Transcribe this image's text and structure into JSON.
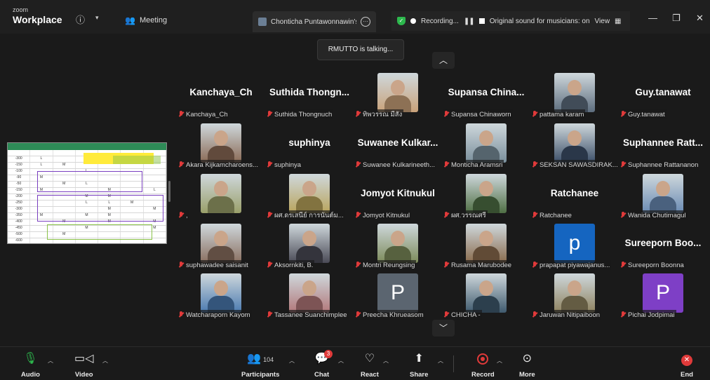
{
  "titlebar": {
    "brand_small": "zoom",
    "brand_big": "Workplace",
    "meeting_label": "Meeting",
    "share_tab_label": "Chonticha Puntawonnawin's s",
    "recording_label": "Recording...",
    "sound_label": "Original sound for musicians: on",
    "view_label": "View"
  },
  "talking": "RMUTTO is talking...",
  "shared_screen": {
    "rows": [
      [
        "",
        "",
        "",
        "",
        "",
        "",
        ""
      ],
      [
        "-300",
        "L",
        "",
        "",
        "",
        "",
        ""
      ],
      [
        "-150",
        "L",
        "M",
        "",
        "",
        "",
        ""
      ],
      [
        "-100",
        "",
        "",
        "L",
        "",
        "",
        ""
      ],
      [
        "-90",
        "M",
        "",
        "",
        "",
        "",
        ""
      ],
      [
        "-50",
        "",
        "M",
        "L",
        "",
        "",
        ""
      ],
      [
        "-150",
        "M",
        "",
        "",
        "M",
        "",
        "L"
      ],
      [
        "-200",
        "",
        "",
        "M",
        "M",
        "",
        ""
      ],
      [
        "-250",
        "",
        "",
        "L",
        "L",
        "M",
        ""
      ],
      [
        "-300",
        "",
        "",
        "",
        "M",
        "",
        "M"
      ],
      [
        "-350",
        "M",
        "",
        "M",
        "M",
        "",
        ""
      ],
      [
        "-400",
        "",
        "M",
        "",
        "M",
        "",
        "M"
      ],
      [
        "-450",
        "",
        "",
        "M",
        "",
        "",
        "M"
      ],
      [
        "-500",
        "",
        "M",
        "",
        "",
        "",
        ""
      ],
      [
        "-600",
        "",
        "",
        "",
        "",
        "",
        ""
      ]
    ]
  },
  "participants": [
    {
      "display": "Kanchaya_Ch",
      "label": "Kanchaya_Ch",
      "type": "name"
    },
    {
      "display": "Suthida Thongn...",
      "label": "Suthida Thongnuch",
      "type": "name"
    },
    {
      "display": "",
      "label": "ทิพวรรณ มีสัง",
      "type": "photo",
      "color": "#c9a27a"
    },
    {
      "display": "Supansa China...",
      "label": "Supansa Chinaworn",
      "type": "name"
    },
    {
      "display": "",
      "label": "pattama karam",
      "type": "photo",
      "color": "#5d6d7e"
    },
    {
      "display": "Guy.tanawat",
      "label": "Guy.tanawat",
      "type": "name"
    },
    {
      "display": "",
      "label": "Akara Kijkamcharoens...",
      "type": "photo",
      "color": "#8a6a55"
    },
    {
      "display": "suphinya",
      "label": "suphinya",
      "type": "name"
    },
    {
      "display": "Suwanee Kulkar...",
      "label": "Suwanee Kulkarineeth...",
      "type": "name"
    },
    {
      "display": "",
      "label": "Monticha Aramsri",
      "type": "photo",
      "color": "#7a8f9c"
    },
    {
      "display": "",
      "label": "SEKSAN SAWASDIRAK...",
      "type": "photo",
      "color": "#3c4f68"
    },
    {
      "display": "Suphannee Ratt...",
      "label": "Suphannee Rattananon",
      "type": "name"
    },
    {
      "display": "",
      "label": ",",
      "type": "photo",
      "color": "#9aa06a"
    },
    {
      "display": "",
      "label": "ผศ.ดรเสนีย์ การนันต์ม...",
      "type": "photo",
      "color": "#b9a45c"
    },
    {
      "display": "Jomyot Kitnukul",
      "label": "Jomyot Kitnukul",
      "type": "name"
    },
    {
      "display": "",
      "label": "ผศ.วรรณศรี",
      "type": "photo",
      "color": "#4f6f44"
    },
    {
      "display": "Ratchanee",
      "label": "Ratchanee",
      "type": "name"
    },
    {
      "display": "",
      "label": "Wanida Chutimagul",
      "type": "photo",
      "color": "#6a8bb4"
    },
    {
      "display": "",
      "label": "suphawadee saisanit",
      "type": "photo",
      "color": "#8a6f60"
    },
    {
      "display": "",
      "label": "Aksornkiti, B.",
      "type": "photo",
      "color": "#4a4a56"
    },
    {
      "display": "",
      "label": "Montri Reungsing",
      "type": "photo",
      "color": "#7c8b5a"
    },
    {
      "display": "",
      "label": "Rusama Marubodee",
      "type": "photo",
      "color": "#8a6b4d"
    },
    {
      "display": "p",
      "label": "prapapat piyawajanus...",
      "type": "letter",
      "color": "#1565c0"
    },
    {
      "display": "Sureeporn Boo...",
      "label": "Sureeporn Boonna",
      "type": "name"
    },
    {
      "display": "",
      "label": "Watcharaporn Kayom",
      "type": "photo",
      "color": "#4a7ab0"
    },
    {
      "display": "",
      "label": "Tassanee Suanchimplee",
      "type": "photo",
      "color": "#b2787a"
    },
    {
      "display": "P",
      "label": "Preecha Khrueasom",
      "type": "letter",
      "color": "#5b6570"
    },
    {
      "display": "",
      "label": "CHICHA -",
      "type": "photo",
      "color": "#3f5a6e"
    },
    {
      "display": "",
      "label": "Jaruwan Nitipaiboon",
      "type": "photo",
      "color": "#8f8360"
    },
    {
      "display": "P",
      "label": "Pichai Jodpimai",
      "type": "letter",
      "color": "#7e3fc6"
    }
  ],
  "toolbar": {
    "audio": "Audio",
    "video": "Video",
    "participants": "Participants",
    "participant_count": "104",
    "chat": "Chat",
    "chat_badge": "3",
    "react": "React",
    "share": "Share",
    "record": "Record",
    "more": "More",
    "end": "End"
  }
}
